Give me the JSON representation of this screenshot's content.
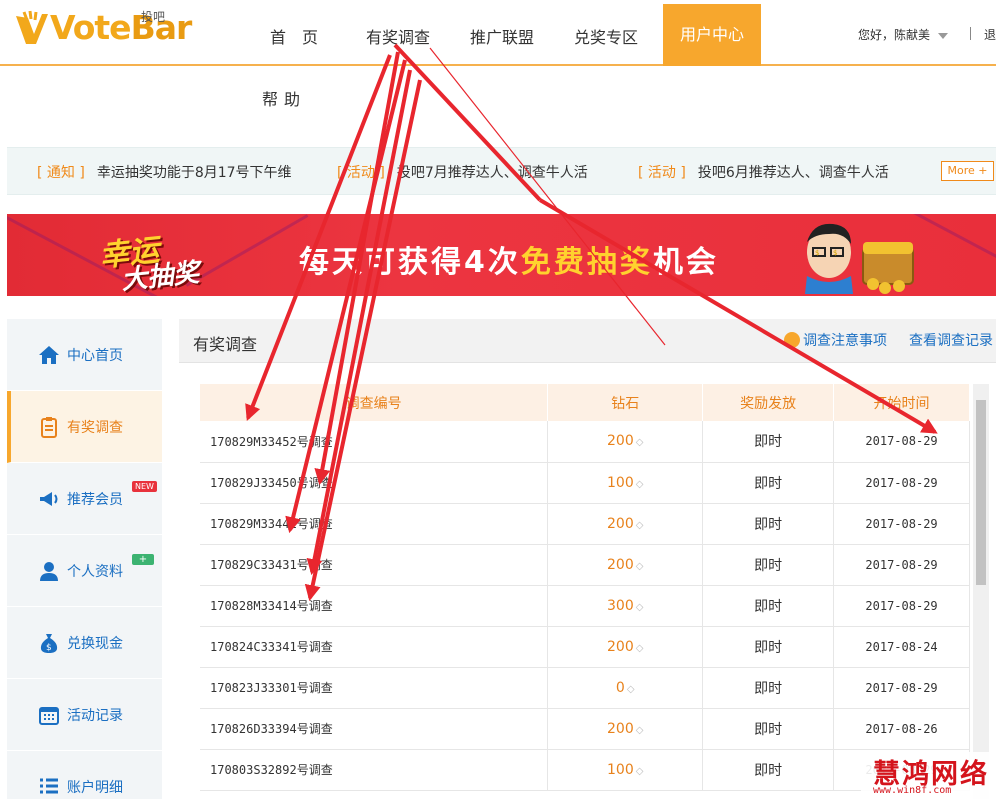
{
  "header": {
    "logo_text_1": "Vote",
    "logo_text_2": "Bar",
    "logo_sub": "投吧",
    "nav": [
      "首　页",
      "有奖调查",
      "推广联盟",
      "兑奖专区"
    ],
    "nav_active": "用户中心",
    "greeting": "您好，陈献美",
    "logout": "退",
    "help": "帮助"
  },
  "notice": {
    "items": [
      {
        "tag": "[ 通知 ]",
        "text": "幸运抽奖功能于8月17号下午维"
      },
      {
        "tag": "[ 活动 ]",
        "text": "投吧7月推荐达人、调查牛人活"
      },
      {
        "tag": "[ 活动 ]",
        "text": "投吧6月推荐达人、调查牛人活"
      }
    ],
    "more": "More +"
  },
  "banner": {
    "lucky_1": "幸运",
    "lucky_2": "大抽奖",
    "slogan_pre": "每天可获得4次",
    "slogan_hl": "免费抽奖",
    "slogan_post": "机会"
  },
  "sidebar": {
    "items": [
      {
        "label": "中心首页",
        "icon": "home-icon"
      },
      {
        "label": "有奖调查",
        "icon": "clipboard-icon",
        "active": true
      },
      {
        "label": "推荐会员",
        "icon": "megaphone-icon",
        "badge": "NEW"
      },
      {
        "label": "个人资料",
        "icon": "user-icon",
        "badge": "+"
      },
      {
        "label": "兑换现金",
        "icon": "money-bag-icon"
      },
      {
        "label": "活动记录",
        "icon": "calendar-icon"
      },
      {
        "label": "账户明细",
        "icon": "list-icon"
      }
    ]
  },
  "panel": {
    "title": "有奖调查",
    "notes_link": "调查注意事项",
    "record_link": "查看调查记录",
    "columns": [
      "调查编号",
      "钻石",
      "奖励发放",
      "开始时间"
    ],
    "rows": [
      {
        "id": "170829M33452号调查",
        "diamonds": "200",
        "reward": "即时",
        "date": "2017-08-29"
      },
      {
        "id": "170829J33450号调查",
        "diamonds": "100",
        "reward": "即时",
        "date": "2017-08-29"
      },
      {
        "id": "170829M33441号调查",
        "diamonds": "200",
        "reward": "即时",
        "date": "2017-08-29"
      },
      {
        "id": "170829C33431号调查",
        "diamonds": "200",
        "reward": "即时",
        "date": "2017-08-29"
      },
      {
        "id": "170828M33414号调查",
        "diamonds": "300",
        "reward": "即时",
        "date": "2017-08-29"
      },
      {
        "id": "170824C33341号调查",
        "diamonds": "200",
        "reward": "即时",
        "date": "2017-08-24"
      },
      {
        "id": "170823J33301号调查",
        "diamonds": "0",
        "reward": "即时",
        "date": "2017-08-29"
      },
      {
        "id": "170826D33394号调查",
        "diamonds": "200",
        "reward": "即时",
        "date": "2017-08-26"
      },
      {
        "id": "170803S32892号调查",
        "diamonds": "100",
        "reward": "即时",
        "date": "2017-08-29"
      }
    ]
  },
  "watermark": {
    "big": "慧鸿网络",
    "small": "www.win8f.com"
  },
  "colors": {
    "accent": "#f7a72d",
    "link": "#1b6fc2",
    "banner": "#e22b35",
    "annotation_arrow": "#e8262e"
  }
}
